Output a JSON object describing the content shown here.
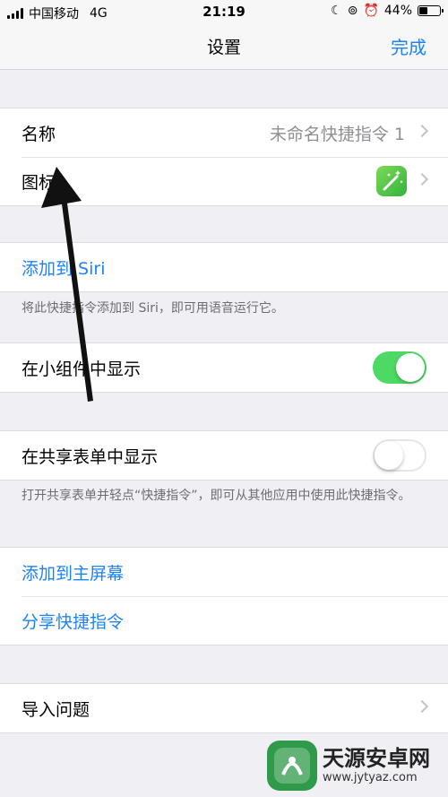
{
  "status_bar": {
    "carrier": "中国移动",
    "network": "4G",
    "time": "21:19",
    "battery": "44%",
    "battery_level": 0.44
  },
  "nav": {
    "title": "设置",
    "done_label": "完成"
  },
  "settings": {
    "name_label": "名称",
    "name_value": "未命名快捷指令 1",
    "icon_label": "图标",
    "add_to_siri_label": "添加到 Siri",
    "add_to_siri_note": "将此快捷指令添加到 Siri，即可用语音运行它。",
    "show_in_widget_label": "在小组件中显示",
    "show_in_widget_on": true,
    "show_in_share_sheet_label": "在共享表单中显示",
    "show_in_share_sheet_on": false,
    "share_sheet_note": "打开共享表单并轻点“快捷指令”，即可从其他应用中使用此快捷指令。",
    "add_to_home_label": "添加到主屏幕",
    "share_shortcut_label": "分享快捷指令",
    "import_questions_label": "导入问题"
  },
  "watermark": {
    "name": "天源安卓网",
    "url": "www.jytyaz.com"
  },
  "colors": {
    "accent": "#1f82f7",
    "toggle_on": "#4cd964",
    "background": "#efeff4"
  }
}
